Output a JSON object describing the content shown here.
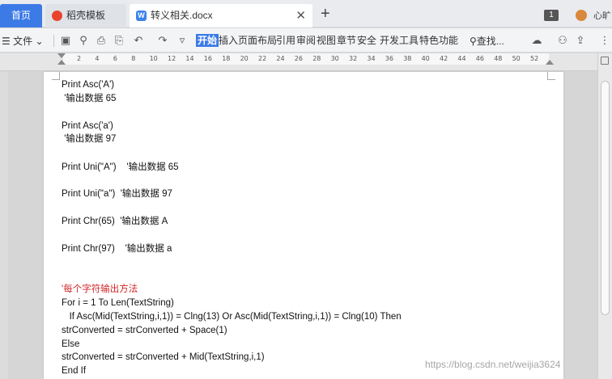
{
  "tabs": {
    "home": "首页",
    "template": "稻壳模板",
    "document": "转义相关.docx",
    "doc_icon": "W"
  },
  "titlebar": {
    "count_badge": "1",
    "user_name": "心旷"
  },
  "menubar": {
    "file_label": "文件",
    "items": [
      "开始",
      "插入",
      "页面布局",
      "引用",
      "审阅",
      "视图",
      "章节",
      "安全",
      "开发工具",
      "特色功能"
    ],
    "search_label": "查找..."
  },
  "ruler": {
    "ticks": [
      "2",
      "4",
      "6",
      "8",
      "10",
      "12",
      "14",
      "16",
      "18",
      "20",
      "22",
      "24",
      "26",
      "28",
      "30",
      "32",
      "34",
      "36",
      "38",
      "40",
      "42",
      "44",
      "46",
      "48",
      "50",
      "52"
    ]
  },
  "document": {
    "lines": [
      "Print Asc('A')",
      " '输出数据 65",
      "Print Asc('a')",
      " '输出数据 97",
      "Print Uni(\"A\")    '输出数据 65",
      "Print Uni(\"a\")  '输出数据 97",
      "Print Chr(65)  '输出数据 A",
      "Print Chr(97)    '输出数据 a",
      "'每个字符输出方法",
      "For i = 1 To Len(TextString)",
      "   If Asc(Mid(TextString,i,1)) = Clng(13) Or Asc(Mid(TextString,i,1)) = Clng(10) Then",
      "strConverted = strConverted + Space(1)",
      "Else",
      "strConverted = strConverted + Mid(TextString,i,1)",
      "End If"
    ]
  },
  "watermark": "https://blog.csdn.net/weijia3624"
}
